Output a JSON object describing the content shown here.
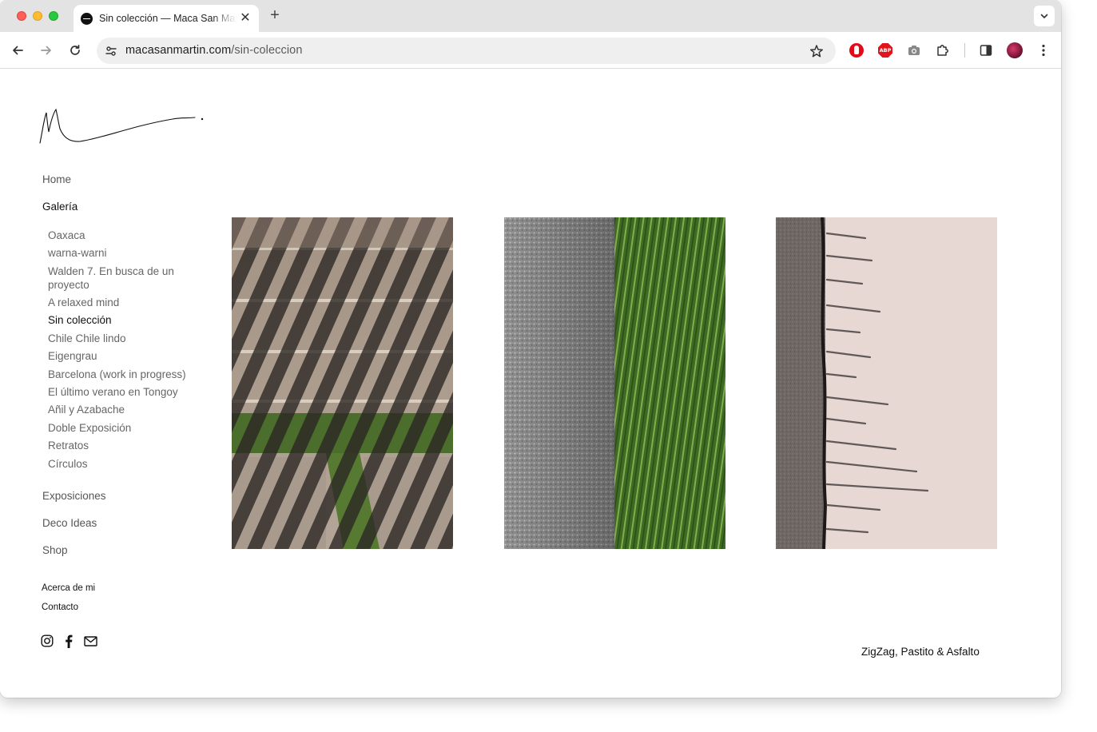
{
  "browser": {
    "tab_title": "Sin colección — Maca San Martín",
    "url_host": "macasanmartin.com",
    "url_path": "/sin-coleccion",
    "extensions": [
      "adblock-icon",
      "adblock-plus-icon",
      "camera-icon",
      "puzzle-extensions-icon"
    ],
    "abp_label": "ABP"
  },
  "site": {
    "logo_alt": "Maca San Martín signature",
    "nav": {
      "home": "Home",
      "galeria": "Galería",
      "galeria_items": [
        "Oaxaca",
        "warna-warni",
        "Walden 7. En busca de un proyecto",
        "A relaxed mind",
        "Sin colección",
        "Chile Chile lindo",
        "Eigengrau",
        "Barcelona (work in progress)",
        "El último verano en Tongoy",
        "Añil y Azabache",
        "Doble Exposición",
        "Retratos",
        "Círculos"
      ],
      "active_item": "Sin colección",
      "exposiciones": "Exposiciones",
      "deco_ideas": "Deco Ideas",
      "shop": "Shop",
      "acerca": "Acerca de mi",
      "contacto": "Contacto"
    },
    "social": [
      "instagram-icon",
      "facebook-icon",
      "mail-icon"
    ],
    "gallery": {
      "photos": [
        {
          "name": "photo-stairs-shadows"
        },
        {
          "name": "photo-gravel-grass"
        },
        {
          "name": "photo-asphalt-concrete"
        }
      ],
      "caption": "ZigZag, Pastito & Asfalto"
    }
  }
}
